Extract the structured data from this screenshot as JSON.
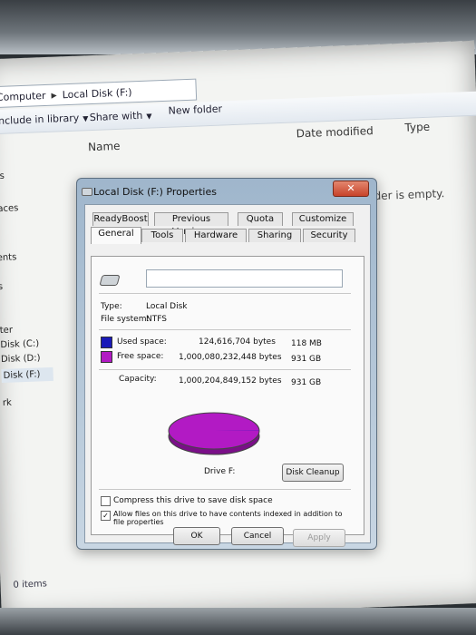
{
  "explorer": {
    "breadcrumb": [
      "Computer",
      "Local Disk (F:)"
    ],
    "toolbar": {
      "include": "Include in library",
      "share": "Share with",
      "new_folder": "New folder"
    },
    "columns": {
      "name": "Name",
      "date": "Date modified",
      "type": "Type"
    },
    "empty_text": "This folder is empty.",
    "nav": [
      "ds",
      "laces",
      "ents",
      "s",
      "ter",
      "Disk (C:)",
      "Disk (D:)",
      "Disk (F:)",
      "rk"
    ],
    "status_items": "0 items"
  },
  "dialog": {
    "title": "Local Disk (F:) Properties",
    "close_label": "✕",
    "tabs_row1": [
      "ReadyBoost",
      "Previous Versions",
      "Quota",
      "Customize"
    ],
    "tabs_row2": [
      "General",
      "Tools",
      "Hardware",
      "Sharing",
      "Security"
    ],
    "general": {
      "type_label": "Type:",
      "type_value": "Local Disk",
      "fs_label": "File system:",
      "fs_value": "NTFS",
      "used_label": "Used space:",
      "used_bytes": "124,616,704 bytes",
      "used_size": "118 MB",
      "free_label": "Free space:",
      "free_bytes": "1,000,080,232,448 bytes",
      "free_size": "931 GB",
      "cap_label": "Capacity:",
      "cap_bytes": "1,000,204,849,152 bytes",
      "cap_size": "931 GB",
      "drive_label": "Drive F:",
      "cleanup_label": "Disk Cleanup",
      "compress_label": "Compress this drive to save disk space",
      "index_label": "Allow files on this drive to have contents indexed in addition to file properties"
    },
    "buttons": {
      "ok": "OK",
      "cancel": "Cancel",
      "apply": "Apply"
    },
    "colors": {
      "used": "#1a1ab8",
      "free": "#b21ac4"
    }
  },
  "chart_data": {
    "type": "pie",
    "categories": [
      "Used space",
      "Free space"
    ],
    "values": [
      124616704,
      1000080232448
    ]
  }
}
